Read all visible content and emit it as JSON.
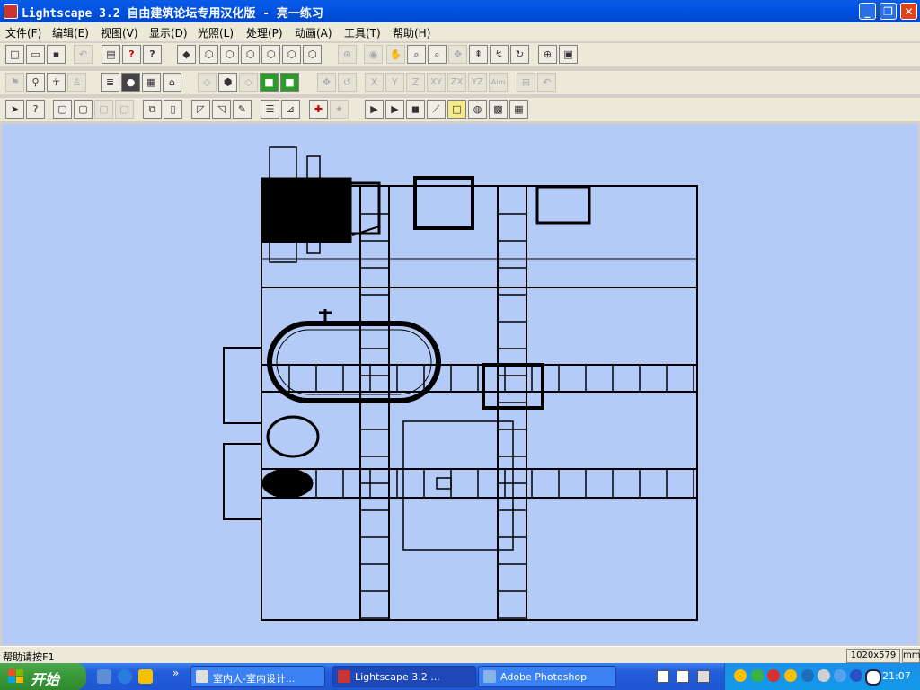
{
  "window": {
    "title": "Lightscape 3.2 自由建筑论坛专用汉化版  - 亮一练习",
    "minimize_glyph": "_",
    "maximize_glyph": "❐",
    "close_glyph": "✕"
  },
  "menu": [
    {
      "label": "文件(F)"
    },
    {
      "label": "编辑(E)"
    },
    {
      "label": "视图(V)"
    },
    {
      "label": "显示(D)"
    },
    {
      "label": "光照(L)"
    },
    {
      "label": "处理(P)"
    },
    {
      "label": "动画(A)"
    },
    {
      "label": "工具(T)"
    },
    {
      "label": "帮助(H)"
    }
  ],
  "toolbar_axis_labels": {
    "x": "X",
    "y": "Y",
    "z": "Z",
    "xy": "XY",
    "zx": "ZX",
    "yz": "YZ",
    "aim": "Aim"
  },
  "toolbar_glyphs": {
    "help": "?",
    "help_pointer": "?"
  },
  "status": {
    "help_text": "帮助请按F1",
    "viewport_size": "1020x579",
    "unit": "mm"
  },
  "taskbar": {
    "start_label": "开始",
    "quick_launch_more": "»",
    "tasks": [
      {
        "label": "室内人-室内设计..."
      },
      {
        "label": "Lightscape 3.2 ..."
      },
      {
        "label": "Adobe Photoshop"
      }
    ],
    "clock": "21:07"
  },
  "colors": {
    "viewport_bg": "#b4cbf7",
    "wireframe": "#000000",
    "titlebar": "#0054e3",
    "taskbar": "#245edb",
    "start": "#3b9a3b"
  }
}
